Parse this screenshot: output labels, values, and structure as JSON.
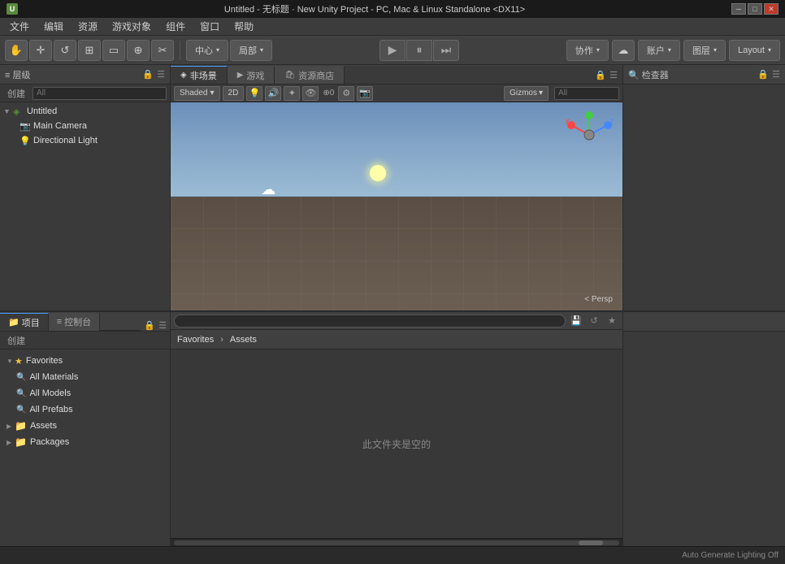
{
  "titlebar": {
    "icon": "U",
    "title": "Untitled - 无标题 · New Unity Project - PC, Mac & Linux Standalone <DX11>",
    "minimize": "─",
    "maximize": "□",
    "close": "✕"
  },
  "menubar": {
    "items": [
      "文件",
      "编辑",
      "资源",
      "游戏对象",
      "组件",
      "窗口",
      "帮助"
    ]
  },
  "toolbar": {
    "hand": "✋",
    "move": "✛",
    "rotate_left": "↺",
    "rotate_right": "↻",
    "scale": "⊞",
    "rect": "▭",
    "transform": "⊕",
    "extra": "✂",
    "pivot_center": "中心",
    "pivot_local": "局部",
    "play": "▶",
    "pause": "⏸",
    "step": "⏭",
    "collaborate": "协作",
    "cloud": "☁",
    "account": "账户",
    "layers": "图层",
    "layout": "Layout"
  },
  "hierarchy": {
    "panel_title": "层级",
    "create_btn": "创建",
    "search_placeholder": "All",
    "items": [
      {
        "name": "Untitled",
        "indent": 0,
        "type": "scene",
        "expanded": true
      },
      {
        "name": "Main Camera",
        "indent": 1,
        "type": "camera"
      },
      {
        "name": "Directional Light",
        "indent": 1,
        "type": "light"
      }
    ]
  },
  "scene": {
    "tabs": [
      {
        "label": "非场景",
        "icon": "◈",
        "active": false
      },
      {
        "label": "游戏",
        "icon": "▶",
        "active": false
      },
      {
        "label": "资源商店",
        "icon": "🛒",
        "active": false
      }
    ],
    "active_tab": "场景",
    "shading": "Shaded",
    "mode_2d": "2D",
    "gizmos_label": "Gizmos",
    "search_placeholder": "All",
    "persp_label": "< Persp"
  },
  "inspector": {
    "panel_title": "检查器"
  },
  "project": {
    "tabs": [
      {
        "label": "项目",
        "icon": "📁",
        "active": true
      },
      {
        "label": "控制台",
        "icon": "≡",
        "active": false
      }
    ],
    "create_btn": "创建",
    "favorites_label": "Favorites",
    "assets_label": "Assets",
    "favorites_items": [
      {
        "name": "All Materials",
        "type": "search"
      },
      {
        "name": "All Models",
        "type": "search"
      },
      {
        "name": "All Prefabs",
        "type": "search"
      }
    ],
    "asset_folders": [
      {
        "name": "Assets",
        "type": "folder"
      },
      {
        "name": "Packages",
        "type": "folder"
      }
    ],
    "empty_text": "此文件夹是空的"
  },
  "statusbar": {
    "text": "Auto Generate Lighting Off"
  }
}
